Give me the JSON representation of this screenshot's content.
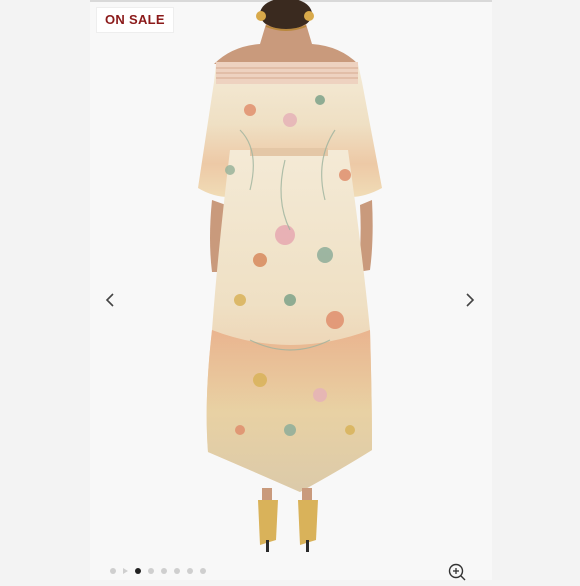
{
  "badge": {
    "label": "ON SALE",
    "color": "#8b1a1a"
  },
  "gallery": {
    "prev_icon": "chevron-left-icon",
    "next_icon": "chevron-right-icon",
    "zoom_icon": "zoom-in-icon",
    "dots": [
      "inactive",
      "video",
      "active",
      "inactive",
      "inactive",
      "inactive",
      "inactive",
      "inactive"
    ]
  },
  "colors": {
    "accent": "#8b1a1a",
    "background": "#f4f4f4",
    "dot_active": "#222222",
    "dot_inactive": "#cfcfcf"
  }
}
